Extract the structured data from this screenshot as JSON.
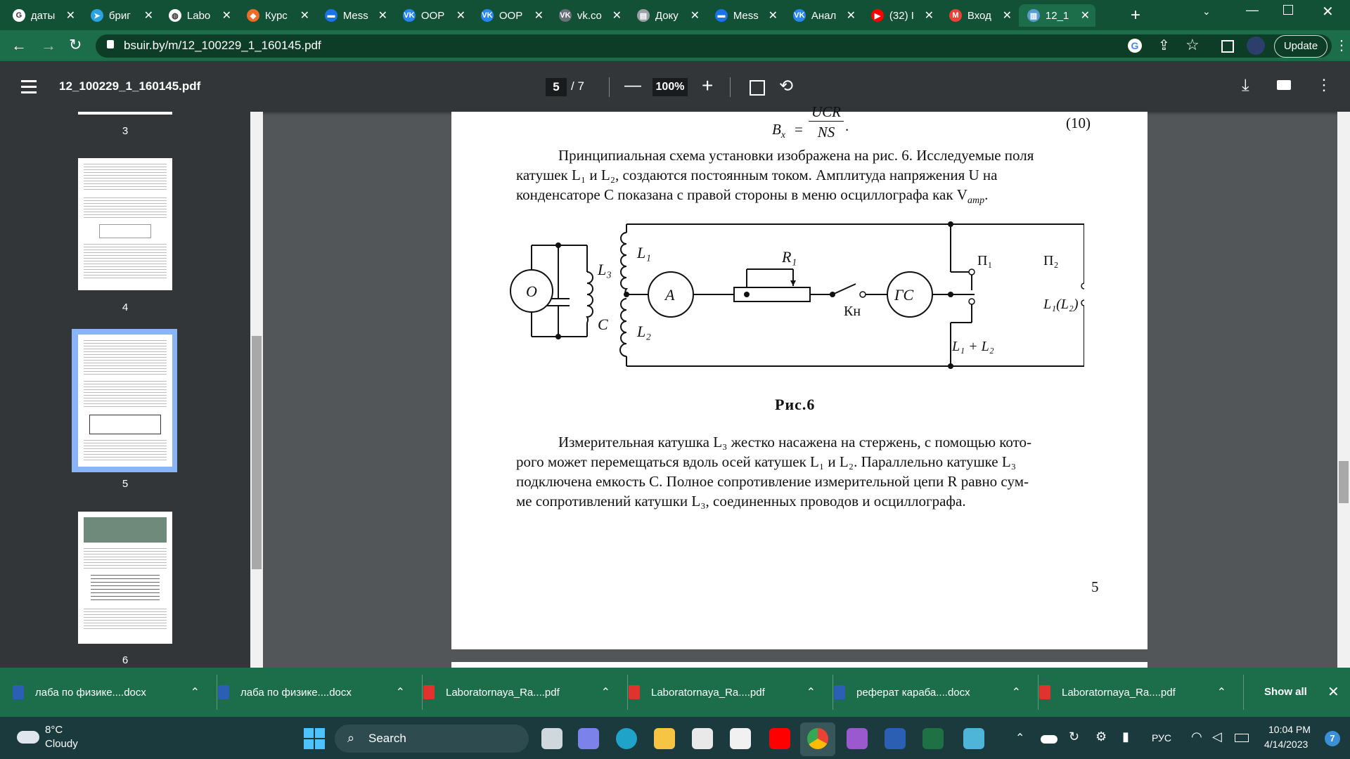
{
  "tabs": [
    {
      "title": "даты",
      "color": "#ffffff",
      "glyph": "G"
    },
    {
      "title": "бриг",
      "color": "#2aa3e0",
      "glyph": "➤"
    },
    {
      "title": "Labo",
      "color": "#ffffff",
      "glyph": "◍"
    },
    {
      "title": "Курс",
      "color": "#f06a28",
      "glyph": "◆"
    },
    {
      "title": "Mess",
      "color": "#1a73e8",
      "glyph": "▬"
    },
    {
      "title": "ООР",
      "color": "#2787f5",
      "glyph": "VK"
    },
    {
      "title": "ООР",
      "color": "#2787f5",
      "glyph": "VK"
    },
    {
      "title": "vk.co",
      "color": "#6a7178",
      "glyph": "VK"
    },
    {
      "title": "Доку",
      "color": "#9aa0a6",
      "glyph": "▤"
    },
    {
      "title": "Mess",
      "color": "#1a73e8",
      "glyph": "▬"
    },
    {
      "title": "Анал",
      "color": "#2787f5",
      "glyph": "VK"
    },
    {
      "title": "(32) I",
      "color": "#ff0000",
      "glyph": "▶"
    },
    {
      "title": "Вход",
      "color": "#ea4335",
      "glyph": "M"
    },
    {
      "title": "12_1",
      "color": "#5b9bd5",
      "glyph": "▥"
    }
  ],
  "address": {
    "url": "bsuir.by/m/12_100229_1_160145.pdf",
    "update_label": "Update"
  },
  "pdf": {
    "filename": "12_100229_1_160145.pdf",
    "current_page": "5",
    "total_pages": "/  7",
    "zoom": "100%",
    "thumb_labels": [
      "3",
      "4",
      "5",
      "6"
    ]
  },
  "page": {
    "formula_lhs": "B",
    "formula_sub": "x",
    "formula_num": "UCR",
    "formula_den": "NS",
    "formula_eq": "=",
    "formula_dot": ".",
    "formula_no": "(10)",
    "para1_line1": "Принципиальная схема установки изображена на рис. 6. Исследуемые поля",
    "para1_line2": "катушек L₁  и  L₂,  создаются постоянным током. Амплитуда напряжения U на",
    "para1_line3": "конденсаторе C показана с правой стороны в меню осциллографа  как V",
    "para1_line3_sub": "amp",
    "para1_line3_end": ".",
    "fig_caption": "Рис.6",
    "circ_O": "O",
    "circ_A": "A",
    "circ_GS": "ГС",
    "lbl_L1": "L₁",
    "lbl_L2": "L₂",
    "lbl_L3": "L₃",
    "lbl_C": "C",
    "lbl_R1": "R₁",
    "lbl_Kn": "Кн",
    "lbl_P1": "П₁",
    "lbl_P2": "П₂",
    "lbl_L1L2sum": "L₁ + L₂",
    "lbl_L1paren": "L₁(L₂)",
    "para2_line1": "Измерительная катушка L₃ жестко насажена на стержень, с помощью кото-",
    "para2_line2": "рого может перемещаться вдоль осей катушек L₁ и L₂. Параллельно катушке L₃",
    "para2_line3": "подключена емкость C. Полное сопротивление измерительной цепи R равно сум-",
    "para2_line4": "ме сопротивлений катушки L₃, соединенных проводов и осциллографа.",
    "page_number": "5"
  },
  "downloads": {
    "items": [
      {
        "name": "лаба по физике....docx",
        "type": "docx"
      },
      {
        "name": "лаба по физике....docx",
        "type": "docx"
      },
      {
        "name": "Laboratornaya_Ra....pdf",
        "type": "pdf"
      },
      {
        "name": "Laboratornaya_Ra....pdf",
        "type": "pdf"
      },
      {
        "name": "реферат караба....docx",
        "type": "docx"
      },
      {
        "name": "Laboratornaya_Ra....pdf",
        "type": "pdf"
      }
    ],
    "show_all": "Show all"
  },
  "taskbar": {
    "temp": "8°C",
    "weather": "Cloudy",
    "search": "Search",
    "lang": "РУС",
    "time": "10:04 PM",
    "date": "4/14/2023",
    "badge": "7"
  }
}
